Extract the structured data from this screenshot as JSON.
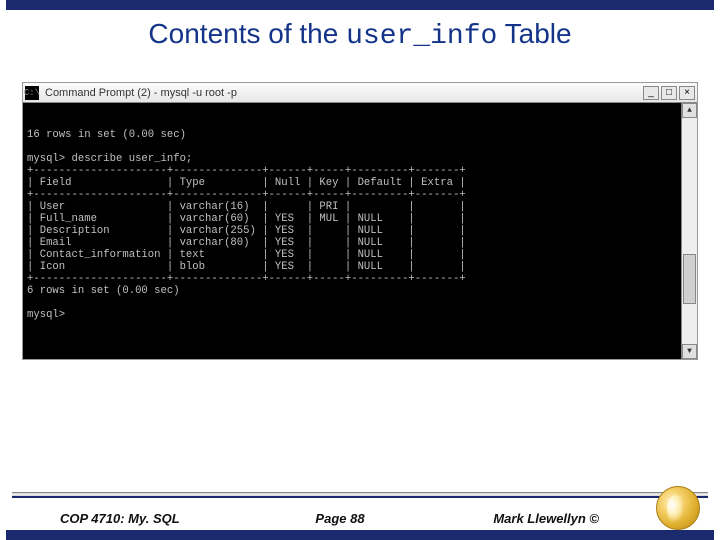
{
  "title": {
    "prefix": "Contents of the ",
    "mono": "user_info",
    "suffix": " Table"
  },
  "cmd": {
    "window_title": "Command Prompt (2) - mysql -u root -p",
    "icon_text": "C:\\",
    "lines": {
      "rows_16": "16 rows in set (0.00 sec)",
      "blank": "",
      "prompt_describe": "mysql> describe user_info;",
      "sep": "+---------------------+--------------+------+-----+---------+-------+",
      "header": "| Field               | Type         | Null | Key | Default | Extra |",
      "r1": "| User                | varchar(16)  |      | PRI |         |       |",
      "r2": "| Full_name           | varchar(60)  | YES  | MUL | NULL    |       |",
      "r3": "| Description         | varchar(255) | YES  |     | NULL    |       |",
      "r4": "| Email               | varchar(80)  | YES  |     | NULL    |       |",
      "r5": "| Contact_information | text         | YES  |     | NULL    |       |",
      "r6": "| Icon                | blob         | YES  |     | NULL    |       |",
      "rows_6": "6 rows in set (0.00 sec)",
      "prompt_empty": "mysql>"
    }
  },
  "footer": {
    "left": "COP 4710: My. SQL",
    "center": "Page 88",
    "right": "Mark Llewellyn ©"
  }
}
